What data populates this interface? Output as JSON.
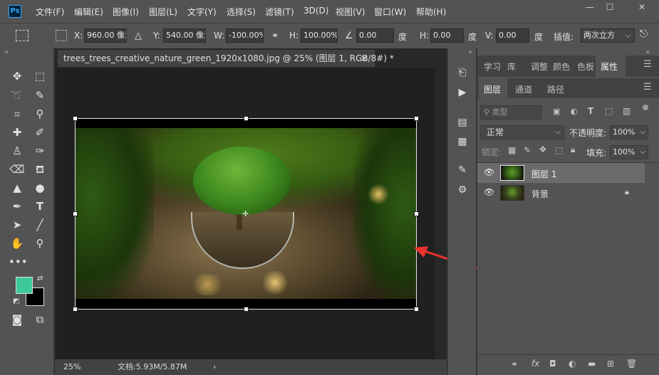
{
  "app": {
    "logo": "Ps"
  },
  "menu": [
    "文件(F)",
    "编辑(E)",
    "图像(I)",
    "图层(L)",
    "文字(Y)",
    "选择(S)",
    "滤镜(T)",
    "3D(D)",
    "视图(V)",
    "窗口(W)",
    "帮助(H)"
  ],
  "window_controls": {
    "minimize": "—",
    "maximize": "☐",
    "close": "✕"
  },
  "options": {
    "x_label": "X:",
    "x_value": "960.00 像素",
    "y_label": "Y:",
    "y_value": "540.00 像素",
    "w_label": "W:",
    "w_value": "-100.00%",
    "h_label": "H:",
    "h_value": "100.00%",
    "angle_value": "0.00",
    "angle_unit": "度",
    "hskew_label": "H:",
    "hskew_value": "0.00",
    "hskew_unit": "度",
    "vskew_label": "V:",
    "vskew_value": "0.00",
    "vskew_unit": "度",
    "interp_label": "插值:",
    "interp_value": "两次立方"
  },
  "document": {
    "tab_title": "trees_trees_creative_nature_green_1920x1080.jpg @ 25% (图层 1, RGB/8#) *",
    "tab_close": "×",
    "zoom": "25%",
    "doc_info": "文档:5.93M/5.87M",
    "status_arrow": "›"
  },
  "colors": {
    "foreground": "#3ec99a",
    "background": "#000000",
    "accent": "#31a8ff"
  },
  "panel_tabs_top": [
    "学习",
    "库",
    "调整",
    "颜色",
    "色板",
    "属性"
  ],
  "panel_tabs_layers": [
    "图层",
    "通道",
    "路径"
  ],
  "layers_panel": {
    "filter_label": "类型",
    "blend_mode": "正常",
    "opacity_label": "不透明度:",
    "opacity_value": "100%",
    "lock_label": "锁定:",
    "fill_label": "填充:",
    "fill_value": "100%"
  },
  "layers": [
    {
      "name": "图层 1",
      "selected": true,
      "visible": true,
      "locked": false
    },
    {
      "name": "背景",
      "selected": false,
      "visible": true,
      "locked": true
    }
  ],
  "icons": {
    "eye": "eye-icon",
    "lock": "lock-icon",
    "link": "link-icon",
    "fx": "fx",
    "collapse": "«"
  }
}
